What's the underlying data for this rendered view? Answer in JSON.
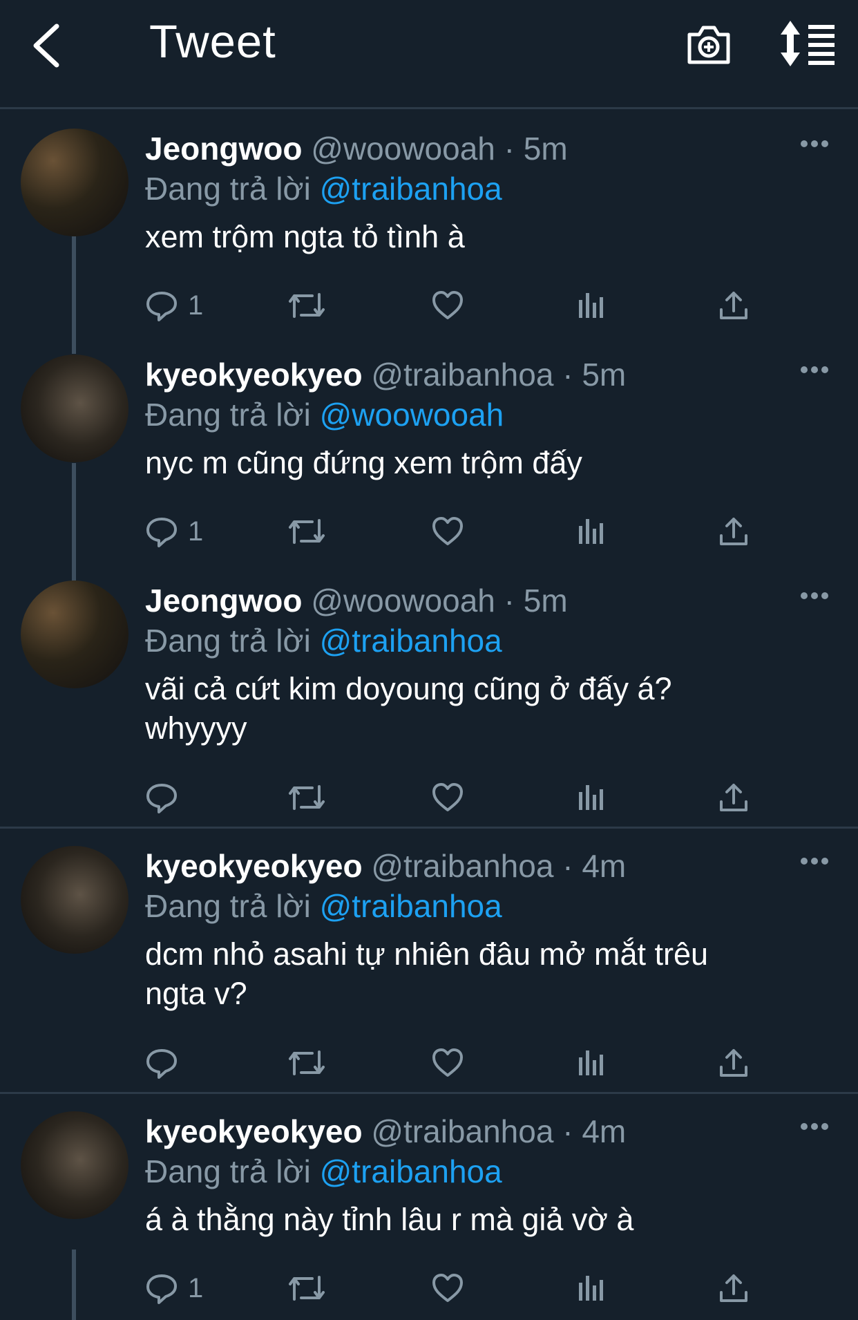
{
  "header": {
    "title": "Tweet"
  },
  "reply_prefix": "Đang trả lời",
  "tweets": [
    {
      "name": "Jeongwoo",
      "handle": "@woowooah",
      "time": "5m",
      "reply_to": "@traibanhoa",
      "text": "xem trộm ngta tỏ tình à",
      "reply_count": "1",
      "avatar": "jeongwoo"
    },
    {
      "name": "kyeokyeokyeo",
      "handle": "@traibanhoa",
      "time": "5m",
      "reply_to": "@woowooah",
      "text": "nyc m cũng đứng xem trộm đấy",
      "reply_count": "1",
      "avatar": "kyeokyeokyeo"
    },
    {
      "name": "Jeongwoo",
      "handle": "@woowooah",
      "time": "5m",
      "reply_to": "@traibanhoa",
      "text": "vãi cả cứt kim doyoung cũng ở đấy á? whyyyy",
      "reply_count": "",
      "avatar": "jeongwoo"
    },
    {
      "name": "kyeokyeokyeo",
      "handle": "@traibanhoa",
      "time": "4m",
      "reply_to": "@traibanhoa",
      "text": "dcm nhỏ asahi tự nhiên đâu mở mắt trêu ngta v?",
      "reply_count": "",
      "avatar": "kyeokyeokyeo"
    },
    {
      "name": "kyeokyeokyeo",
      "handle": "@traibanhoa",
      "time": "4m",
      "reply_to": "@traibanhoa",
      "text": "á à thằng này tỉnh lâu r mà giả vờ à",
      "reply_count": "1",
      "avatar": "kyeokyeokyeo"
    }
  ],
  "colors": {
    "background": "#15202b",
    "secondary_text": "#8899a6",
    "mention": "#1da1f2",
    "divider": "#2c3a48"
  },
  "icons": [
    "back-arrow-icon",
    "camera-plus-icon",
    "sort-icon",
    "reply-icon",
    "retweet-icon",
    "like-icon",
    "analytics-icon",
    "share-icon",
    "more-icon"
  ]
}
